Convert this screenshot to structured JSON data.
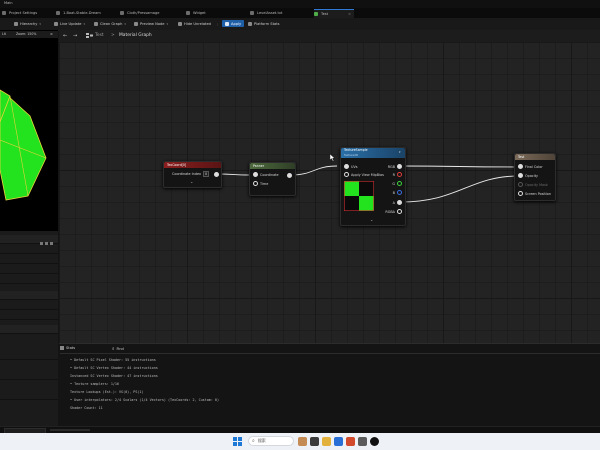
{
  "window": {
    "title": "Main"
  },
  "tabs": [
    {
      "label": "Project Settings"
    },
    {
      "label": "1-Boat-Stable-Dream"
    },
    {
      "label": "Cloth/Pressamage"
    },
    {
      "label": "Widget"
    },
    {
      "label": "LevelAsset.txt"
    },
    {
      "label": "Test"
    }
  ],
  "toolbar": {
    "hierarchy": "Hierarchy",
    "live_update": "Live Update",
    "clean_graph": "Clean Graph",
    "preview_node": "Preview Node",
    "hide_unrelated": "Hide Unrelated",
    "apply": "Apply",
    "platform_stats": "Platform Stats"
  },
  "viewport": {
    "mode": "Lit",
    "zoom": "Zoom: 150%"
  },
  "graph": {
    "breadcrumb_root": "Test",
    "breadcrumb_sep": ">",
    "breadcrumb_current": "Material Graph",
    "nav_back": "←",
    "nav_forward": "→"
  },
  "nodes": {
    "texcoord": {
      "title": "TexCoord[0]",
      "pin": "Coordinate Index",
      "value": "0"
    },
    "panner": {
      "title": "Panner",
      "in1": "Coordinate",
      "in2": "Time"
    },
    "texsample": {
      "title": "TextureSample",
      "subtitle": "Texture2D",
      "in1": "UVs",
      "in2": "Apply View MipBias",
      "out_rgb": "RGB",
      "out_r": "R",
      "out_g": "G",
      "out_b": "B",
      "out_a": "A",
      "out_rgba": "RGBA"
    },
    "result": {
      "title": "Test",
      "in1": "Final Color",
      "in2": "Opacity",
      "in3": "Opacity Mask",
      "in4": "Screen Position"
    }
  },
  "stats_panel": {
    "tab": "Stats",
    "search_icon_label": "Find",
    "lines": [
      "• Default SC Pixel Shader: 55 instructions",
      "• Default SC Vertex Shader: 44 instructions",
      "  Instanced SC Vertex Shader: 47 instructions",
      "• Texture samplers: 1/16",
      "  Texture Lookups (Est.): VS(0), PS(1)",
      "• User interpolators: 2/4 Scalars (1/4 Vectors) (TexCoords: 2, Custom: 0)",
      "  Shader Count: 11"
    ]
  },
  "taskbar": {
    "search_placeholder": "搜索"
  },
  "colors": {
    "accent": "#2f7ad6",
    "texcoord_header": "#8b1e1e",
    "panner_header": "#4d6a3d",
    "texsample_header": "#2a6fa8",
    "result_header": "#7b6a59",
    "preview_green": "#22e31e"
  }
}
